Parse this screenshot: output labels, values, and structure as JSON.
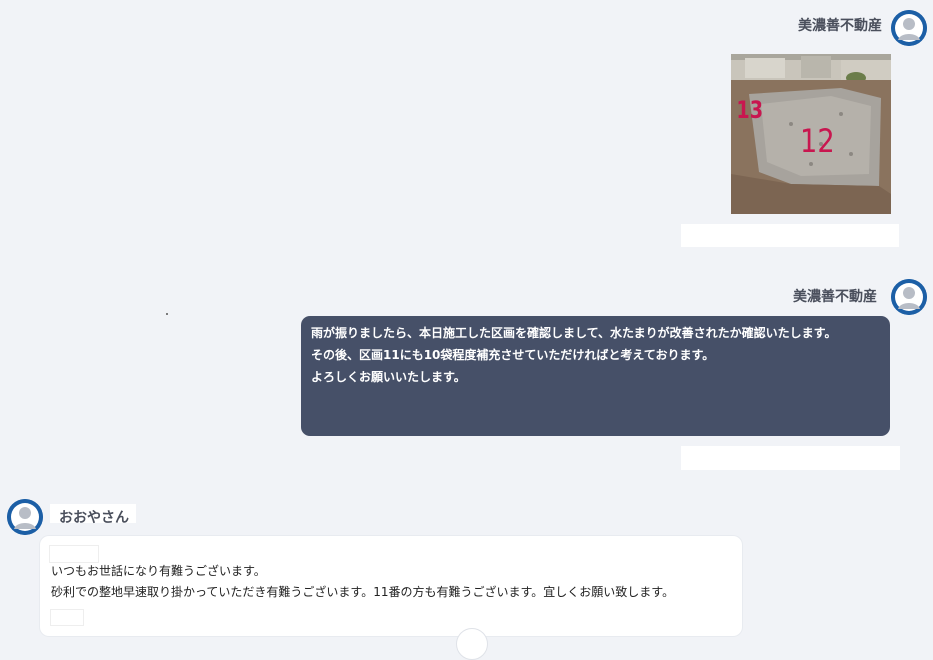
{
  "messages": [
    {
      "sender": "美濃善不動産",
      "type": "image",
      "image_labels": [
        "13",
        "12"
      ]
    },
    {
      "sender": "美濃善不動産",
      "type": "text",
      "lines": [
        "雨が振りましたら、本日施工した区画を確認しまして、水たまりが改善されたか確認いたします。",
        "その後、区画11にも10袋程度補充させていただければと考えております。",
        "よろしくお願いいたします。"
      ]
    },
    {
      "sender": "おおやさん",
      "type": "text",
      "lines": [
        "いつもお世話になり有難うございます。",
        "砂利での整地早速取り掛かっていただき有難うございます。11番の方も有難うございます。宜しくお願い致します。"
      ]
    }
  ],
  "icons": {
    "avatar": "user-avatar-icon"
  },
  "colors": {
    "background": "#f1f3f7",
    "outgoing_bubble": "#465068",
    "incoming_bubble": "#ffffff",
    "avatar": "#1c5fa6"
  }
}
